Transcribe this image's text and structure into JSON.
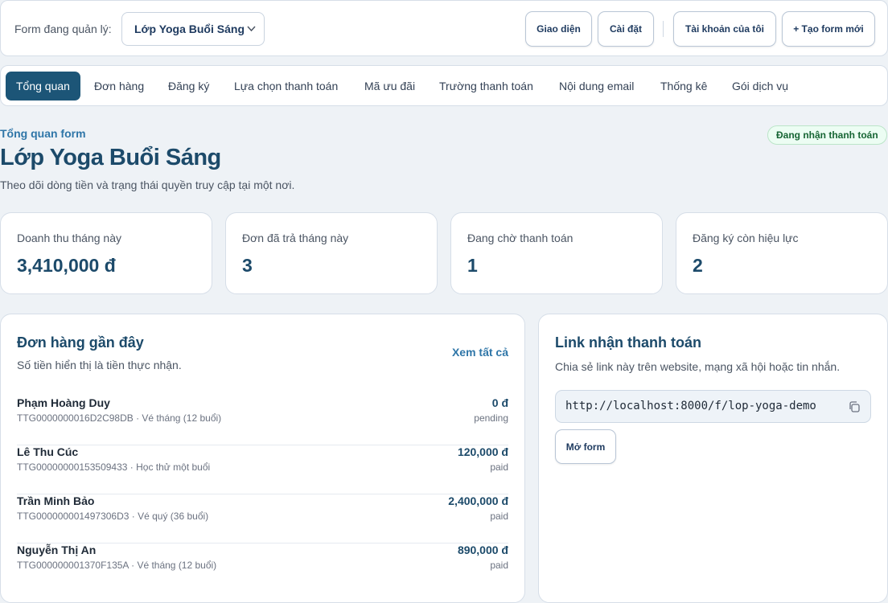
{
  "header": {
    "label": "Form đang quản lý:",
    "selected_form": "Lớp Yoga Buổi Sáng",
    "buttons": {
      "theme": "Giao diện",
      "settings": "Cài đặt",
      "account": "Tài khoản của tôi",
      "new_form": "+ Tạo form mới"
    }
  },
  "tabs": [
    {
      "label": "Tổng quan",
      "active": true
    },
    {
      "label": "Đơn hàng"
    },
    {
      "label": "Đăng ký"
    },
    {
      "label": "Lựa chọn thanh toán"
    },
    {
      "label": "Mã ưu đãi"
    },
    {
      "label": "Trường thanh toán"
    },
    {
      "label": "Nội dung email"
    },
    {
      "label": "Thống kê"
    },
    {
      "label": "Gói dịch vụ"
    }
  ],
  "page": {
    "eyebrow": "Tổng quan form",
    "title": "Lớp Yoga Buổi Sáng",
    "subtitle": "Theo dõi dòng tiền và trạng thái quyền truy cập tại một nơi.",
    "status_badge": "Đang nhận thanh toán"
  },
  "stats": [
    {
      "label": "Doanh thu tháng này",
      "value": "3,410,000 đ"
    },
    {
      "label": "Đơn đã trả tháng này",
      "value": "3"
    },
    {
      "label": "Đang chờ thanh toán",
      "value": "1"
    },
    {
      "label": "Đăng ký còn hiệu lực",
      "value": "2"
    }
  ],
  "recent_orders": {
    "title": "Đơn hàng gần đây",
    "subtitle": "Số tiền hiển thị là tiền thực nhận.",
    "see_all": "Xem tất cả",
    "items": [
      {
        "name": "Phạm Hoàng Duy",
        "meta": "TTG0000000016D2C98DB · Vé tháng (12 buổi)",
        "amount": "0 đ",
        "status": "pending"
      },
      {
        "name": "Lê Thu Cúc",
        "meta": "TTG00000000153509433 · Học thử một buổi",
        "amount": "120,000 đ",
        "status": "paid"
      },
      {
        "name": "Trần Minh Bảo",
        "meta": "TTG000000001497306D3 · Vé quý (36 buổi)",
        "amount": "2,400,000 đ",
        "status": "paid"
      },
      {
        "name": "Nguyễn Thị An",
        "meta": "TTG000000001370F135A · Vé tháng (12 buổi)",
        "amount": "890,000 đ",
        "status": "paid"
      }
    ]
  },
  "payment_link": {
    "title": "Link nhận thanh toán",
    "subtitle": "Chia sẻ link này trên website, mạng xã hội hoặc tin nhắn.",
    "url": "http://localhost:8000/f/lop-yoga-demo",
    "open_button": "Mở form"
  },
  "colors": {
    "primary": "#1c5577",
    "accent_link": "#2f76a8",
    "success_text": "#166534"
  }
}
